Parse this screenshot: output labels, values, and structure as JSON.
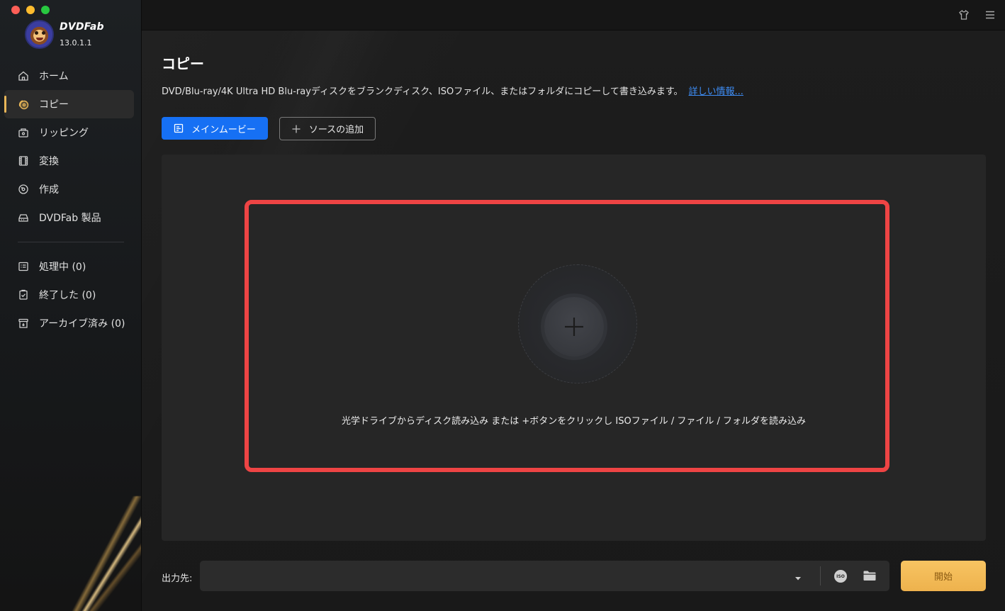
{
  "window": {
    "traffic_lights": [
      "close",
      "minimize",
      "maximize"
    ]
  },
  "brand": {
    "name": "DVDFab",
    "version": "13.0.1.1",
    "logo_icon": "monkey-mascot-logo"
  },
  "sidebar": {
    "items": [
      {
        "label": "ホーム",
        "icon": "home-icon",
        "active": false
      },
      {
        "label": "コピー",
        "icon": "disc-copy-icon",
        "active": true
      },
      {
        "label": "リッピング",
        "icon": "ripper-icon",
        "active": false
      },
      {
        "label": "変換",
        "icon": "film-convert-icon",
        "active": false
      },
      {
        "label": "作成",
        "icon": "disc-create-icon",
        "active": false
      },
      {
        "label": "DVDFab 製品",
        "icon": "drive-products-icon",
        "active": false
      }
    ],
    "queue": [
      {
        "label": "処理中 (0)",
        "icon": "task-list-icon"
      },
      {
        "label": "終了した (0)",
        "icon": "clipboard-check-icon"
      },
      {
        "label": "アーカイブ済み (0)",
        "icon": "archive-box-icon"
      }
    ]
  },
  "topbar": {
    "icons": [
      "shirt-theme-icon",
      "hamburger-menu-icon"
    ]
  },
  "main": {
    "title": "コピー",
    "description": "DVD/Blu-ray/4K Ultra HD Blu-rayディスクをブランクディスク、ISOファイル、またはフォルダにコピーして書き込みます。",
    "more_link": "詳しい情報...",
    "main_movie_button": "メインムービー",
    "add_source_button": "ソースの追加",
    "drop_hint": "光学ドライブからディスク読み込み または +ボタンをクリックし ISOファイル / ファイル / フォルダを読み込み"
  },
  "output": {
    "label": "出力先:",
    "value": "",
    "iso_label": "ISO",
    "start_button": "開始"
  },
  "colors": {
    "accent_blue": "#1670f4",
    "start_gold": "#f2b955",
    "highlight_red": "#ee4444",
    "link_blue": "#3e8ef7"
  }
}
